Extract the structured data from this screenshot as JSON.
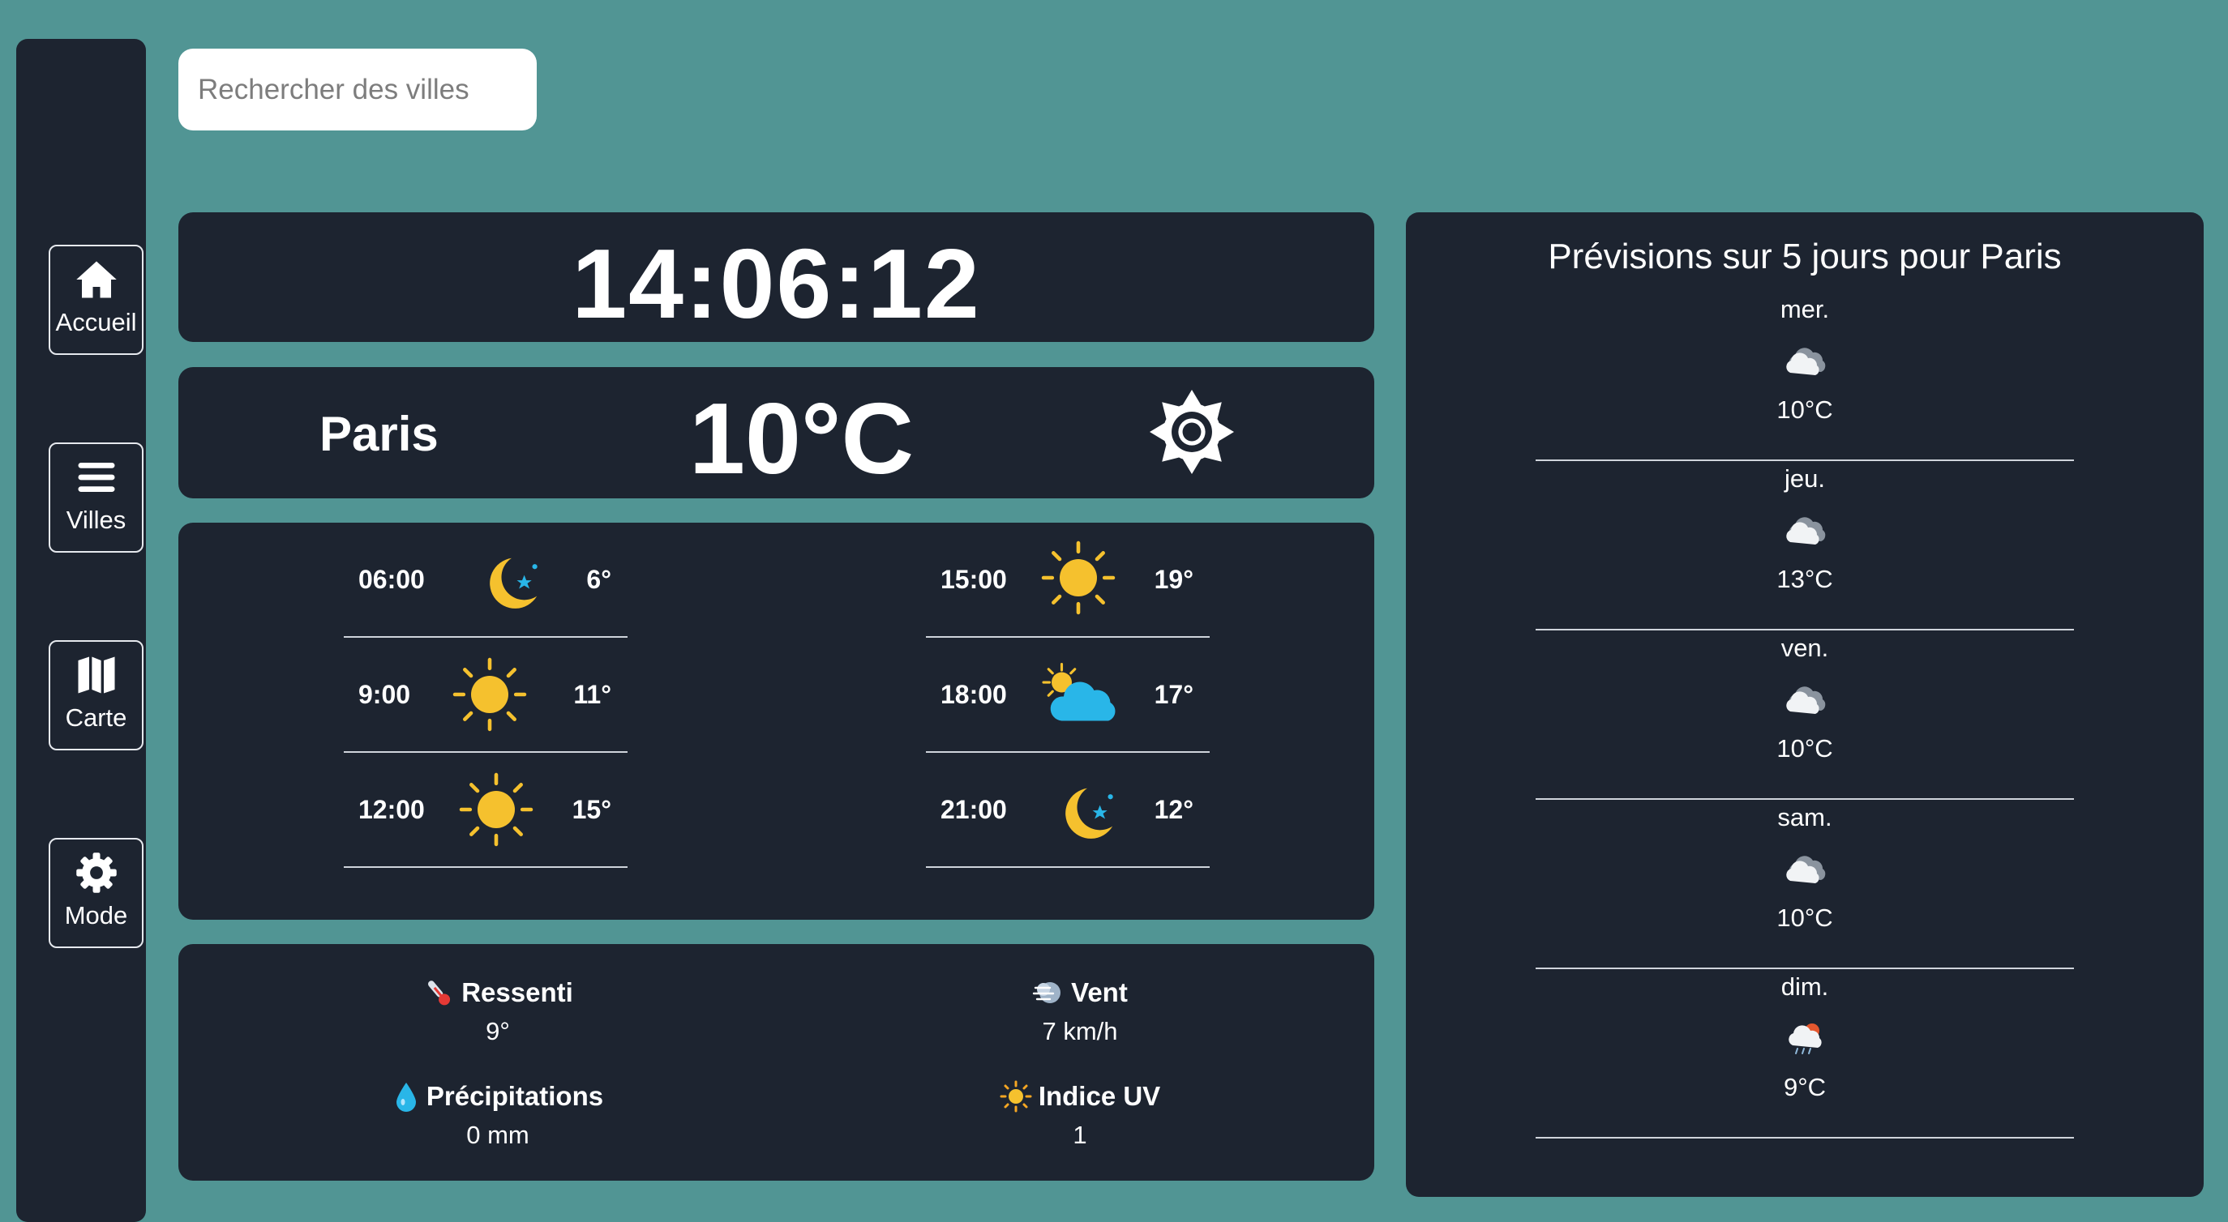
{
  "search": {
    "placeholder": "Rechercher des villes"
  },
  "nav": [
    {
      "label": "Accueil",
      "icon": "home-icon"
    },
    {
      "label": "Villes",
      "icon": "list-icon"
    },
    {
      "label": "Carte",
      "icon": "map-icon"
    },
    {
      "label": "Mode",
      "icon": "gear-icon"
    }
  ],
  "clock": "14:06:12",
  "current": {
    "city": "Paris",
    "temp": "10°C",
    "icon": "sun-outline-icon"
  },
  "hourly": [
    {
      "time": "06:00",
      "temp": "6°",
      "icon": "moon-icon"
    },
    {
      "time": "9:00",
      "temp": "11°",
      "icon": "sun-icon"
    },
    {
      "time": "12:00",
      "temp": "15°",
      "icon": "sun-icon"
    },
    {
      "time": "15:00",
      "temp": "19°",
      "icon": "sun-icon"
    },
    {
      "time": "18:00",
      "temp": "17°",
      "icon": "sun-cloud-icon"
    },
    {
      "time": "21:00",
      "temp": "12°",
      "icon": "moon-icon"
    }
  ],
  "details": [
    {
      "label": "Ressenti",
      "value": "9°",
      "icon": "thermometer-icon"
    },
    {
      "label": "Vent",
      "value": "7 km/h",
      "icon": "wind-icon"
    },
    {
      "label": "Précipitations",
      "value": "0 mm",
      "icon": "droplet-icon"
    },
    {
      "label": "Indice UV",
      "value": "1",
      "icon": "small-sun-icon"
    }
  ],
  "forecast": {
    "title": "Prévisions sur 5 jours pour Paris",
    "days": [
      {
        "day": "mer.",
        "temp": "10°C",
        "icon": "cloud-icon"
      },
      {
        "day": "jeu.",
        "temp": "13°C",
        "icon": "cloud-icon"
      },
      {
        "day": "ven.",
        "temp": "10°C",
        "icon": "cloud-icon"
      },
      {
        "day": "sam.",
        "temp": "10°C",
        "icon": "cloud-icon"
      },
      {
        "day": "dim.",
        "temp": "9°C",
        "icon": "cloud-rain-icon"
      }
    ]
  },
  "colors": {
    "background": "#519594",
    "panel": "#1d2430",
    "sun": "#f5c12e",
    "cloud": "#29b6e8"
  }
}
